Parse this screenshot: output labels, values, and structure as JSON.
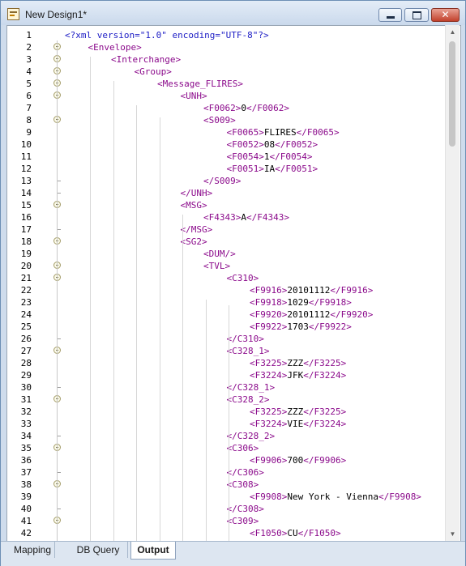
{
  "window": {
    "title": "New Design1*",
    "icon": "mapforce-design-icon",
    "controls": [
      "minimize-icon",
      "maximize-icon",
      "close-icon"
    ]
  },
  "tabs": [
    {
      "label": "Mapping"
    },
    {
      "label": "DB Query"
    },
    {
      "label": "Output",
      "active": true
    }
  ],
  "lines": [
    {
      "n": "1",
      "text": "<?xml version=\"1.0\" encoding=\"UTF-8\"?>",
      "kind": "pi"
    },
    {
      "n": "2",
      "text": "<Envelope>",
      "kind": "tag"
    },
    {
      "n": "3",
      "text": "<Interchange>",
      "kind": "tag"
    },
    {
      "n": "4",
      "text": "<Group>",
      "kind": "tag"
    },
    {
      "n": "5",
      "text": "<Message_FLIRES>",
      "kind": "tag"
    },
    {
      "n": "6",
      "text": "<UNH>",
      "kind": "tag"
    },
    {
      "n": "7",
      "open": "<F0062>",
      "value": "0",
      "close": "</F0062>"
    },
    {
      "n": "8",
      "text": "<S009>",
      "kind": "tag"
    },
    {
      "n": "9",
      "open": "<F0065>",
      "value": "FLIRES",
      "close": "</F0065>"
    },
    {
      "n": "10",
      "open": "<F0052>",
      "value": "08",
      "close": "</F0052>"
    },
    {
      "n": "11",
      "open": "<F0054>",
      "value": "1",
      "close": "</F0054>"
    },
    {
      "n": "12",
      "open": "<F0051>",
      "value": "IA",
      "close": "</F0051>"
    },
    {
      "n": "13",
      "text": "</S009>",
      "kind": "tag"
    },
    {
      "n": "14",
      "text": "</UNH>",
      "kind": "tag"
    },
    {
      "n": "15",
      "text": "<MSG>",
      "kind": "tag"
    },
    {
      "n": "16",
      "open": "<F4343>",
      "value": "A",
      "close": "</F4343>"
    },
    {
      "n": "17",
      "text": "</MSG>",
      "kind": "tag"
    },
    {
      "n": "18",
      "text": "<SG2>",
      "kind": "tag"
    },
    {
      "n": "19",
      "text": "<DUM/>",
      "kind": "tag"
    },
    {
      "n": "20",
      "text": "<TVL>",
      "kind": "tag"
    },
    {
      "n": "21",
      "text": "<C310>",
      "kind": "tag"
    },
    {
      "n": "22",
      "open": "<F9916>",
      "value": "20101112",
      "close": "</F9916>"
    },
    {
      "n": "23",
      "open": "<F9918>",
      "value": "1029",
      "close": "</F9918>"
    },
    {
      "n": "24",
      "open": "<F9920>",
      "value": "20101112",
      "close": "</F9920>"
    },
    {
      "n": "25",
      "open": "<F9922>",
      "value": "1703",
      "close": "</F9922>"
    },
    {
      "n": "26",
      "text": "</C310>",
      "kind": "tag"
    },
    {
      "n": "27",
      "text": "<C328_1>",
      "kind": "tag"
    },
    {
      "n": "28",
      "open": "<F3225>",
      "value": "ZZZ",
      "close": "</F3225>"
    },
    {
      "n": "29",
      "open": "<F3224>",
      "value": "JFK",
      "close": "</F3224>"
    },
    {
      "n": "30",
      "text": "</C328_1>",
      "kind": "tag"
    },
    {
      "n": "31",
      "text": "<C328_2>",
      "kind": "tag"
    },
    {
      "n": "32",
      "open": "<F3225>",
      "value": "ZZZ",
      "close": "</F3225>"
    },
    {
      "n": "33",
      "open": "<F3224>",
      "value": "VIE",
      "close": "</F3224>"
    },
    {
      "n": "34",
      "text": "</C328_2>",
      "kind": "tag"
    },
    {
      "n": "35",
      "text": "<C306>",
      "kind": "tag"
    },
    {
      "n": "36",
      "open": "<F9906>",
      "value": "700",
      "close": "</F9906>"
    },
    {
      "n": "37",
      "text": "</C306>",
      "kind": "tag"
    },
    {
      "n": "38",
      "text": "<C308>",
      "kind": "tag"
    },
    {
      "n": "39",
      "open": "<F9908>",
      "value": "New York - Vienna",
      "close": "</F9908>"
    },
    {
      "n": "40",
      "text": "</C308>",
      "kind": "tag"
    },
    {
      "n": "41",
      "text": "<C309>",
      "kind": "tag"
    },
    {
      "n": "42",
      "open": "<F1050>",
      "value": "CU",
      "close": "</F1050>"
    }
  ],
  "colors": {
    "tag": "#8b0a8b",
    "declaration": "#1d1dc5",
    "text": "#000000"
  }
}
